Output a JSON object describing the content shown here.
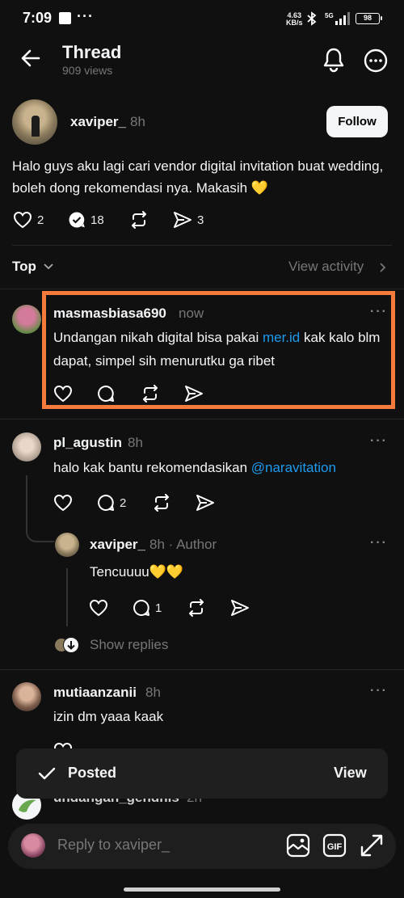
{
  "status_bar": {
    "time": "7:09",
    "dots": "···",
    "speed_value": "4.63",
    "speed_unit": "KB/s",
    "network": "5G",
    "battery": "98"
  },
  "header": {
    "title": "Thread",
    "views": "909 views"
  },
  "post": {
    "username": "xaviper_",
    "time": "8h",
    "follow_label": "Follow",
    "text": "Halo guys aku lagi cari vendor digital invitation buat wedding, boleh dong rekomendasi nya. Makasih 💛",
    "likes": "2",
    "replies": "18",
    "shares": "3"
  },
  "sort": {
    "label": "Top",
    "view_activity": "View activity"
  },
  "comments": [
    {
      "username": "masmasbiasa690",
      "time": "now",
      "text_before": "Undangan nikah digital bisa pakai ",
      "link": "mer.id",
      "text_after": " kak kalo blm dapat, simpel sih menurutku ga ribet",
      "more": "···"
    },
    {
      "username": "pl_agustin",
      "time": "8h",
      "text_before": "halo kak bantu rekomendasikan ",
      "link": "@naravitation",
      "reply_count": "2",
      "more": "···"
    },
    {
      "username": "xaviper_",
      "time": "8h · Author",
      "text": "Tencuuuu💛💛",
      "reply_count": "1",
      "more": "···"
    },
    {
      "username": "mutiaanzanii",
      "time": "8h",
      "text": "izin dm yaaa kaak",
      "more": "···"
    },
    {
      "username": "undangan_gendhis",
      "time": "2h"
    }
  ],
  "show_replies": "Show replies",
  "toast": {
    "label": "Posted",
    "action": "View"
  },
  "composer": {
    "placeholder": "Reply to xaviper_",
    "gif_label": "GIF"
  },
  "colors": {
    "background": "#101010",
    "link": "#1d9bf0",
    "highlight": "#f47b3c"
  }
}
